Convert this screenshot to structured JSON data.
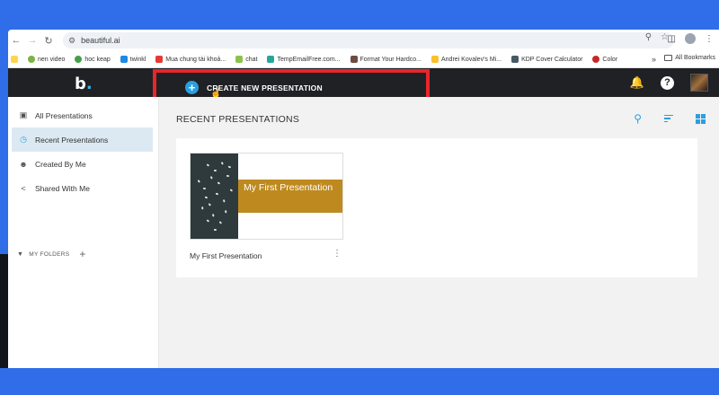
{
  "browser": {
    "url": "beautiful.ai",
    "bookmarks": [
      {
        "label": "nen video",
        "color": "#7cb342"
      },
      {
        "label": "hoc keap",
        "color": "#43a047"
      },
      {
        "label": "twinkl",
        "color": "#1e88e5"
      },
      {
        "label": "Mua chung tài khoả...",
        "color": "#e53935"
      },
      {
        "label": "chat",
        "color": "#8bc34a"
      },
      {
        "label": "TempEmailFree.com...",
        "color": "#26a69a"
      },
      {
        "label": "Format Your Hardco...",
        "color": "#6d4c41"
      },
      {
        "label": "Andrei Kovalev's Mi...",
        "color": "#fbc02d"
      },
      {
        "label": "KDP Cover Calculator",
        "color": "#455a64"
      },
      {
        "label": "Color",
        "color": "#c62828"
      }
    ],
    "more": "»",
    "all_bookmarks": "All Bookmarks"
  },
  "app": {
    "logo_letter": "b",
    "logo_dot": ".",
    "create_button_label": "CREATE NEW PRESENTATION",
    "accent_color": "#2a9fe0",
    "highlight_color": "#e8262b"
  },
  "sidebar": {
    "items": [
      {
        "label": "All Presentations",
        "icon": "grid-box-icon",
        "active": false
      },
      {
        "label": "Recent Presentations",
        "icon": "clock-icon",
        "active": true
      },
      {
        "label": "Created By Me",
        "icon": "person-icon",
        "active": false
      },
      {
        "label": "Shared With Me",
        "icon": "share-icon",
        "active": false
      }
    ],
    "folders_label": "MY FOLDERS"
  },
  "main": {
    "title": "RECENT PRESENTATIONS",
    "presentations": [
      {
        "name": "My First Presentation",
        "thumb_title": "My First Presentation",
        "thumb_band_color": "#be8a1f"
      }
    ]
  }
}
